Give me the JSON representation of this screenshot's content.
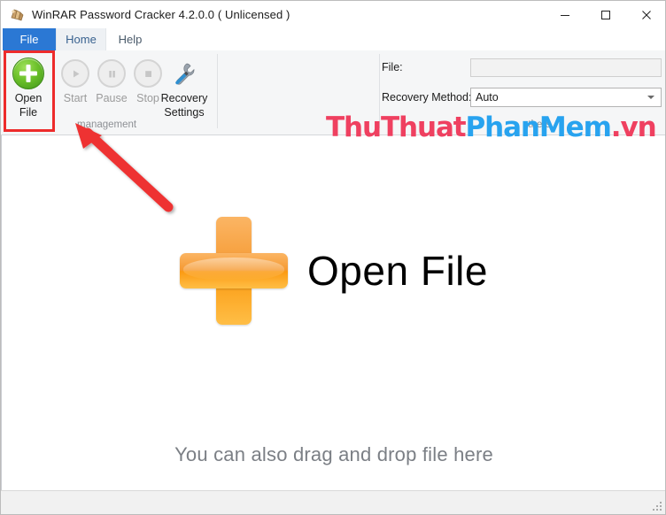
{
  "window": {
    "title": "WinRAR Password Cracker 4.2.0.0  ( Unlicensed )",
    "app_icon": "winrar-books-icon",
    "controls": {
      "minimize": "minimize-icon",
      "maximize": "maximize-icon",
      "close": "close-icon"
    }
  },
  "tabs": [
    {
      "label": "File",
      "state": "file-menu"
    },
    {
      "label": "Home",
      "state": "selected"
    },
    {
      "label": "Help",
      "state": "normal"
    }
  ],
  "quick_access": [
    {
      "icon": "chevron-up-icon"
    },
    {
      "icon": "help-question-icon"
    },
    {
      "icon": "hand-pointer-icon"
    }
  ],
  "ribbon": {
    "buttons": [
      {
        "label_line1": "Open",
        "label_line2": "File",
        "icon": "green-plus-circle-icon",
        "enabled": true
      },
      {
        "label_line1": "Start",
        "label_line2": "",
        "icon": "play-icon",
        "enabled": false
      },
      {
        "label_line1": "Pause",
        "label_line2": "",
        "icon": "pause-icon",
        "enabled": false
      },
      {
        "label_line1": "Stop",
        "label_line2": "",
        "icon": "stop-icon",
        "enabled": false
      },
      {
        "label_line1": "Recovery",
        "label_line2": "Settings",
        "icon": "wrench-screwdriver-icon",
        "enabled": true
      }
    ],
    "group_management": "management",
    "group_others": "others"
  },
  "form": {
    "file_label": "File:",
    "file_value": "",
    "file_placeholder": "",
    "recovery_label": "Recovery Method:",
    "recovery_value": "Auto",
    "recovery_options": [
      "Auto"
    ]
  },
  "content": {
    "open_file_text": "Open File",
    "plus_icon": "orange-plus-icon",
    "drag_text": "You can also drag and drop file here"
  },
  "annotations": {
    "highlight_color": "#ed2b2b",
    "arrow_color": "#ee3333"
  },
  "watermark": {
    "part1": "ThuThuat",
    "part2": "PhanMem",
    "part3": ".vn",
    "color1": "#ef4060",
    "color2": "#28a3ef",
    "color3": "#ef4060"
  }
}
